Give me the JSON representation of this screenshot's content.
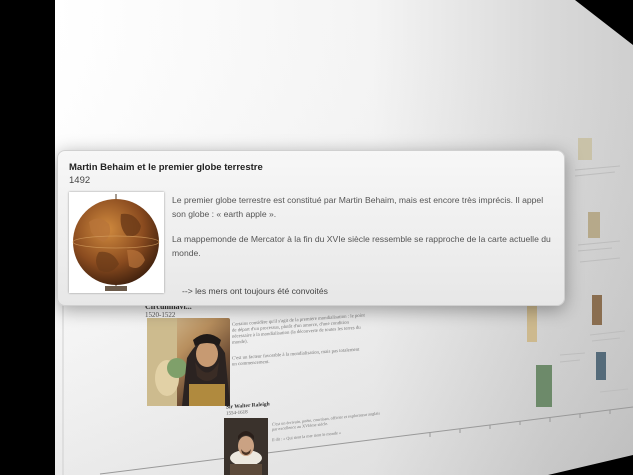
{
  "popup": {
    "title": "Martin Behaim et le premier globe terrestre",
    "year": "1492",
    "paragraph1": "Le premier globe terrestre est constitué par Martin Behaim, mais est encore très imprécis. Il appel son globe : « earth apple ».",
    "paragraph2": "La mappemonde de Mercator à la fin du XVIe siècle ressemble se rapproche de la carte actuelle du monde.",
    "link": "--> les mers ont toujours été convoités",
    "image_icon": "globe-image"
  },
  "background_page": {
    "section1_heading": "Circumnavi...",
    "section1_years": "1520-1522",
    "section1_text1": "Certains considère qu'il s'agit de la première mondialisation : le point de départ d'un processus, plutôt d'un amorce, d'une condition nécessaire à la mondialisation (la découverte de toutes les terres du monde).",
    "section1_text2": "C'est un facteur favorable à la mondialisation, mais pas totalement un commencement.",
    "section2_heading": "Sir Walter Raleigh",
    "section2_years": "1554-1618",
    "section2_text1": "C'est un écrivain, poète, courtisan, officier et explorateur anglais par excellence au XVIème siècle.",
    "section2_text2": "Il dit : « Qui tient la mer tient le monde »"
  }
}
